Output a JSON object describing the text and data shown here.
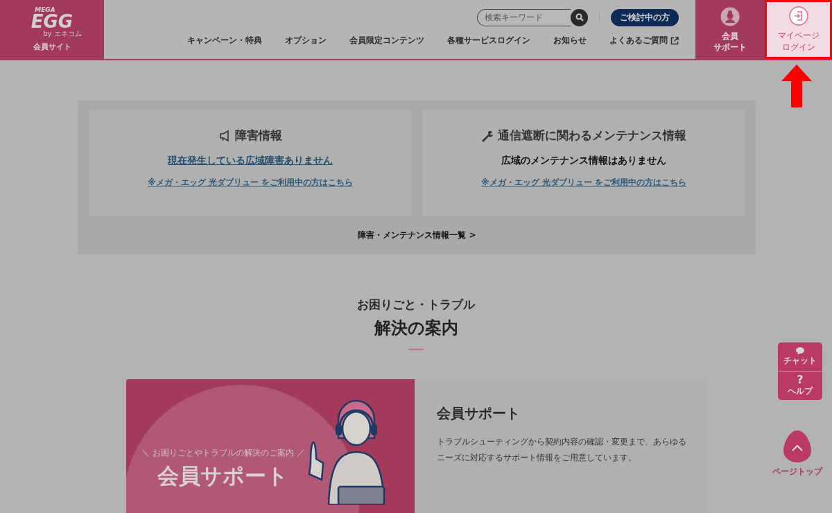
{
  "logo": {
    "brand_top": "MEGA",
    "brand": "EGG",
    "brand_by": "by エネコム",
    "caption": "会員サイト"
  },
  "search": {
    "placeholder": "検索キーワード"
  },
  "prospect_button": "ご検討中の方",
  "nav": [
    {
      "label": "キャンペーン・特典",
      "external": false
    },
    {
      "label": "オプション",
      "external": false
    },
    {
      "label": "会員限定コンテンツ",
      "external": false
    },
    {
      "label": "各種サービスログイン",
      "external": false
    },
    {
      "label": "お知らせ",
      "external": false
    },
    {
      "label": "よくあるご質問",
      "external": true
    }
  ],
  "member_support": {
    "lines": [
      "会員",
      "サポート"
    ]
  },
  "login": {
    "lines": [
      "マイページ",
      "ログイン"
    ],
    "highlighted": true
  },
  "status_cards": [
    {
      "kind": "outage",
      "title": "障害情報",
      "message": "現在発生している広域障害ありません",
      "message_is_link": true,
      "sub_link": "※メガ・エッグ 光ダブリュー をご利用中の方はこちら"
    },
    {
      "kind": "maintenance",
      "title": "通信遮断に関わるメンテナンス情報",
      "message": "広域のメンテナンス情報はありません",
      "message_is_link": false,
      "sub_link": "※メガ・エッグ 光ダブリュー をご利用中の方はこちら"
    }
  ],
  "status_list_link": "障害・メンテナンス情報一覧 >",
  "section": {
    "kicker": "お困りごと・トラブル",
    "title": "解決の案内"
  },
  "support_card": {
    "banner_caption": "＼ お困りごとやトラブルの解決のご案内 ／",
    "banner_title": "会員サポート",
    "title": "会員サポート",
    "description": "トラブルシューティングから契約内容の確認・変更まで、あらゆるニーズに対応するサポート情報をご用意しています。"
  },
  "floating": {
    "chat": "チャット",
    "help_mark": "?",
    "help": "ヘルプ",
    "page_top": "ページトップ"
  }
}
